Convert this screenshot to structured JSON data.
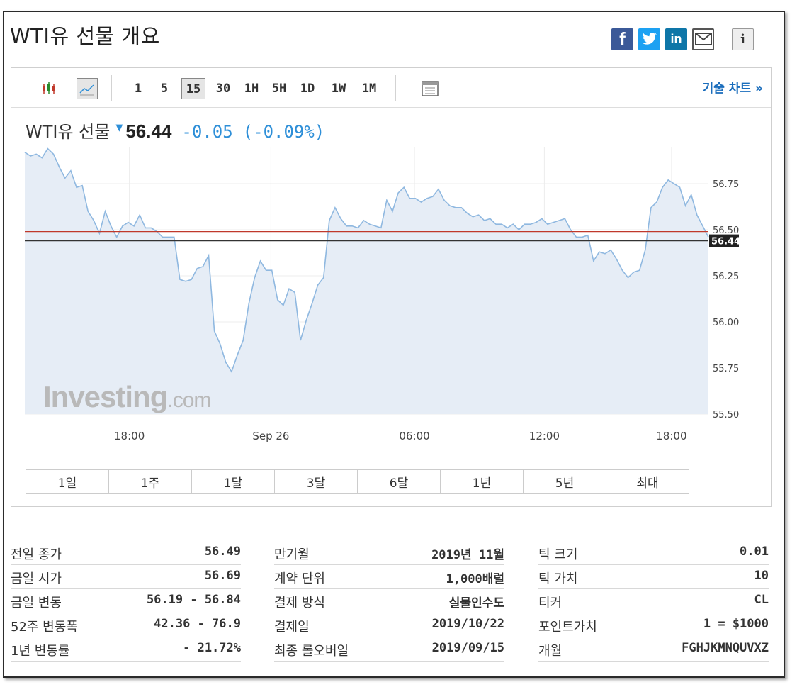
{
  "title": "WTI유 선물 개요",
  "share": {
    "facebook_glyph": "f",
    "twitter_glyph": "t",
    "linkedin_glyph": "in",
    "info_glyph": "i",
    "icons": [
      "facebook-icon",
      "twitter-icon",
      "linkedin-icon",
      "mail-icon",
      "info-icon"
    ]
  },
  "toolbar": {
    "timeframes": [
      "1",
      "5",
      "15",
      "30",
      "1H",
      "5H",
      "1D",
      "1W",
      "1M"
    ],
    "selected_timeframe": "15",
    "selected_chart_type": "line",
    "tech_chart_link": "기술 차트 »"
  },
  "instrument": {
    "name": "WTI유 선물",
    "price": "56.44",
    "change": "-0.05",
    "change_pct": "(-0.09%)",
    "direction": "down"
  },
  "watermark": {
    "brand": "Investing",
    "suffix": ".com"
  },
  "colors": {
    "line": "#8fb8e0",
    "area": "#e6edf6",
    "prev_close_line": "#c0392b",
    "current_line": "#333333",
    "accent": "#2e8fd8",
    "link": "#1a6dbc"
  },
  "chart_data": {
    "type": "area",
    "ylim": [
      55.5,
      56.95
    ],
    "y_ticks": [
      55.5,
      55.75,
      56.0,
      56.25,
      56.5,
      56.75
    ],
    "y_tick_labels": [
      "55.50",
      "55.75",
      "56.00",
      "56.25",
      "56.50",
      "56.75"
    ],
    "x_tick_labels": [
      "18:00",
      "Sep 26",
      "06:00",
      "12:00",
      "18:00"
    ],
    "x_tick_positions": [
      0.153,
      0.36,
      0.57,
      0.76,
      0.946
    ],
    "prev_close": 56.49,
    "current": 56.44,
    "current_label": "56.44",
    "grid": true,
    "values": [
      56.92,
      56.9,
      56.91,
      56.89,
      56.94,
      56.91,
      56.84,
      56.78,
      56.82,
      56.73,
      56.74,
      56.6,
      56.55,
      56.48,
      56.6,
      56.52,
      56.46,
      56.52,
      56.54,
      56.52,
      56.58,
      56.51,
      56.51,
      56.49,
      56.46,
      56.46,
      56.46,
      56.23,
      56.22,
      56.23,
      56.29,
      56.3,
      56.36,
      55.95,
      55.88,
      55.78,
      55.73,
      55.82,
      55.9,
      56.1,
      56.24,
      56.33,
      56.28,
      56.28,
      56.12,
      56.09,
      56.18,
      56.16,
      55.9,
      56.01,
      56.1,
      56.2,
      56.24,
      56.55,
      56.62,
      56.56,
      56.52,
      56.52,
      56.51,
      56.55,
      56.53,
      56.52,
      56.51,
      56.66,
      56.6,
      56.7,
      56.73,
      56.67,
      56.67,
      56.65,
      56.67,
      56.68,
      56.72,
      56.66,
      56.63,
      56.62,
      56.62,
      56.59,
      56.57,
      56.58,
      56.55,
      56.56,
      56.53,
      56.53,
      56.51,
      56.53,
      56.5,
      56.53,
      56.53,
      56.54,
      56.56,
      56.53,
      56.54,
      56.55,
      56.56,
      56.5,
      56.46,
      56.46,
      56.47,
      56.33,
      56.38,
      56.37,
      56.39,
      56.34,
      56.28,
      56.24,
      56.27,
      56.28,
      56.39,
      56.62,
      56.65,
      56.73,
      56.77,
      56.75,
      56.73,
      56.63,
      56.69,
      56.58,
      56.52,
      56.46
    ]
  },
  "ranges": [
    "1일",
    "1주",
    "1달",
    "3달",
    "6달",
    "1년",
    "5년",
    "최대"
  ],
  "stats": [
    [
      {
        "label": "전일 종가",
        "value": "56.49"
      },
      {
        "label": "금일 시가",
        "value": "56.69"
      },
      {
        "label": "금일 변동",
        "value": "56.19 - 56.84"
      },
      {
        "label": "52주 변동폭",
        "value": "42.36 - 76.9"
      },
      {
        "label": "1년 변동률",
        "value": "- 21.72%"
      }
    ],
    [
      {
        "label": "만기월",
        "value": "2019년 11월"
      },
      {
        "label": "계약 단위",
        "value": "1,000배럴"
      },
      {
        "label": "결제 방식",
        "value": "실물인수도"
      },
      {
        "label": "결제일",
        "value": "2019/10/22"
      },
      {
        "label": "최종 롤오버일",
        "value": "2019/09/15"
      }
    ],
    [
      {
        "label": "틱 크기",
        "value": "0.01"
      },
      {
        "label": "틱 가치",
        "value": "10"
      },
      {
        "label": "티커",
        "value": "CL"
      },
      {
        "label": "포인트가치",
        "value": "1 = $1000"
      },
      {
        "label": "개월",
        "value": "FGHJKMNQUVXZ"
      }
    ]
  ]
}
